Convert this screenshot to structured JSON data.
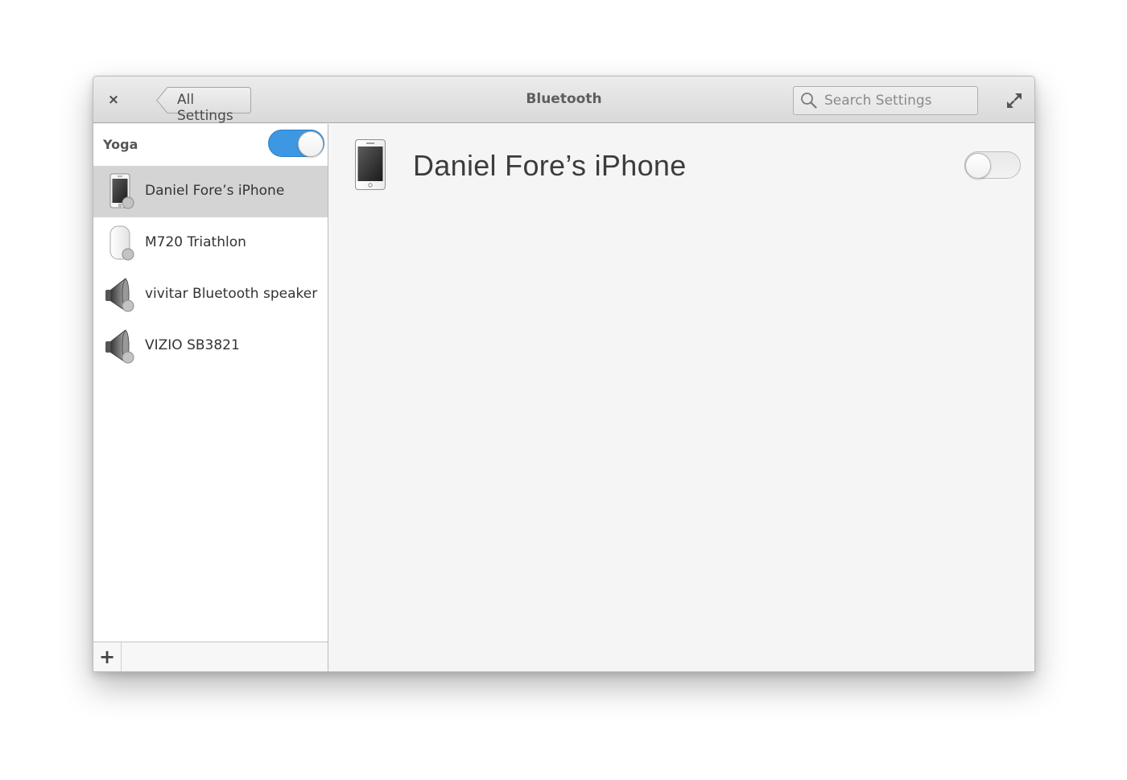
{
  "header": {
    "close_label": "×",
    "back_label": "All Settings",
    "title": "Bluetooth",
    "search_placeholder": "Search Settings"
  },
  "sidebar": {
    "adapter": {
      "name": "Yoga",
      "enabled": true
    },
    "devices": [
      {
        "label": "Daniel Fore’s iPhone",
        "icon": "phone-icon",
        "selected": true
      },
      {
        "label": "M720 Triathlon",
        "icon": "mouse-icon",
        "selected": false
      },
      {
        "label": "vivitar Bluetooth speaker",
        "icon": "speaker-icon",
        "selected": false
      },
      {
        "label": "VIZIO SB3821",
        "icon": "speaker-icon",
        "selected": false
      }
    ],
    "add_label": "+"
  },
  "detail": {
    "device_name": "Daniel Fore’s iPhone",
    "icon": "phone-icon",
    "connected": false
  },
  "colors": {
    "accent": "#3d97e3",
    "selected_row": "#d4d4d4"
  }
}
